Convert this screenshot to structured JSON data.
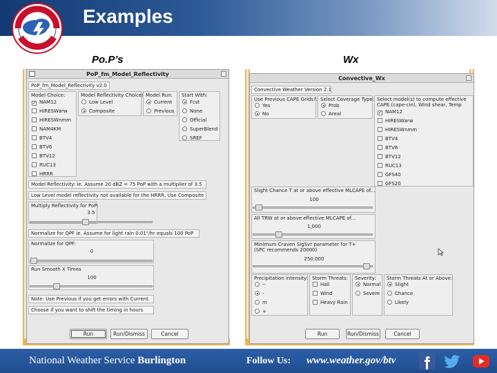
{
  "slide": {
    "title": "Examples",
    "left_label": "Po.P’s",
    "right_label": "Wx"
  },
  "colors": {
    "header_dark": "#143a73",
    "footer_blue": "#1e4c8f",
    "window_accent": "#f1b54e"
  },
  "pop_window": {
    "title": "PoP_fm_Model_Reflectivity",
    "version": "PoP_fm_Model_Reflectivity v2.0",
    "model_choice": {
      "title": "Model Choice:",
      "items": [
        {
          "label": "NAM12",
          "checked": true
        },
        {
          "label": "HIRESWarw",
          "checked": false
        },
        {
          "label": "HIRESWnmm",
          "checked": false
        },
        {
          "label": "NAM4KM",
          "checked": false
        },
        {
          "label": "BTV4",
          "checked": false
        },
        {
          "label": "BTV6",
          "checked": false
        },
        {
          "label": "BTV12",
          "checked": false
        },
        {
          "label": "RUC13",
          "checked": false
        },
        {
          "label": "HRRR",
          "checked": false
        }
      ]
    },
    "reflectivity_choice": {
      "title": "Model Reflectivity Choices:",
      "items": [
        {
          "label": "Low Level",
          "checked": false
        },
        {
          "label": "Composite",
          "checked": true
        }
      ]
    },
    "model_run": {
      "title": "Model Run:",
      "items": [
        {
          "label": "Current",
          "checked": true
        },
        {
          "label": "Previous",
          "checked": false
        }
      ]
    },
    "start_with": {
      "title": "Start With:",
      "items": [
        {
          "label": "Fcst",
          "checked": true
        },
        {
          "label": "None",
          "checked": false
        },
        {
          "label": "Official",
          "checked": false
        },
        {
          "label": "SuperBlend",
          "checked": false
        },
        {
          "label": "SREF",
          "checked": false
        }
      ]
    },
    "note_reflectivity": "Model Reflectivity: ie. Assume 20 dBZ = 75 PoP with a multiplier of 3.5",
    "note_lowlevel": "Low Level model reflectivity not available for the HRRR, Use Composite",
    "multiply": {
      "label": "Multiply Reflectivity for PoP:",
      "value": "3.5",
      "fraction": 0.45
    },
    "normalize_note": "Normalize for QPF ie. Assume for light rain 0.01\"/hr equals 100 PoP",
    "normalize": {
      "label": "Normalize for QPF:",
      "value": "0",
      "fraction": 0.0
    },
    "smooth": {
      "label": "Run Smooth X Times",
      "value": "100",
      "fraction": 0.2
    },
    "note_previous": "Note: Use Previous if you get errors with Current.",
    "note_shift": "Choose if you want to shift the timing in hours",
    "buttons": {
      "run": "Run",
      "run_dismiss": "Run/Dismiss",
      "cancel": "Cancel"
    }
  },
  "wx_window": {
    "title": "Convective_Wx",
    "version": "Convective Weather Version 2.1",
    "use_previous": {
      "title": "Use Previous CAPE Grids?:",
      "items": [
        {
          "label": "Yes",
          "checked": false
        },
        {
          "label": "No",
          "checked": true
        }
      ]
    },
    "coverage": {
      "title": "Select Coverage Type:",
      "items": [
        {
          "label": "Prob",
          "checked": true
        },
        {
          "label": "Areal",
          "checked": false
        }
      ]
    },
    "models": {
      "title": "Select model(s) to compute effective CAPE (cape-cin), Wind shear, Temp",
      "items": [
        {
          "label": "NAM12",
          "checked": true
        },
        {
          "label": "HIRESWarw",
          "checked": false
        },
        {
          "label": "HIRESWnmm",
          "checked": false
        },
        {
          "label": "BTV4",
          "checked": false
        },
        {
          "label": "BTV6",
          "checked": false
        },
        {
          "label": "BTV12",
          "checked": false
        },
        {
          "label": "RUC13",
          "checked": false
        },
        {
          "label": "GFS40",
          "checked": false
        },
        {
          "label": "GFS20",
          "checked": false
        }
      ]
    },
    "slight_chance": {
      "label": "Slight Chance T at or above effective MLCAPE of...",
      "value": "100",
      "fraction": 0.02
    },
    "all_trw": {
      "label": "All TRW at or above effective MLCAPE of...",
      "value": "1,000",
      "fraction": 0.2
    },
    "craven": {
      "label": "Minimum Craven SigSvr parameter for T+",
      "sub": "(SPC recommends 20000)",
      "value": "250,000",
      "fraction": 0.98
    },
    "precip": {
      "title": "Precipitation intensity:",
      "items": [
        {
          "label": "--",
          "checked": false
        },
        {
          "label": "-",
          "checked": true
        },
        {
          "label": "m",
          "checked": false
        },
        {
          "label": "+",
          "checked": false
        }
      ]
    },
    "threats": {
      "title": "Storm Threats:",
      "items": [
        {
          "label": "Hail",
          "checked": false
        },
        {
          "label": "Wind",
          "checked": false
        },
        {
          "label": "Heavy Rain",
          "checked": false
        }
      ]
    },
    "severity": {
      "title": "Severity:",
      "items": [
        {
          "label": "Normal",
          "checked": true
        },
        {
          "label": "Severe",
          "checked": false
        }
      ]
    },
    "threats_above": {
      "title": "Storm Threats At or Above:",
      "items": [
        {
          "label": "Slight",
          "checked": true
        },
        {
          "label": "Chance",
          "checked": false
        },
        {
          "label": "Likely",
          "checked": false
        }
      ]
    },
    "buttons": {
      "run": "Run",
      "run_dismiss": "Run/Dismiss",
      "cancel": "Cancel"
    }
  },
  "footer": {
    "org_prefix": "National Weather Service ",
    "org_office": "Burlington",
    "follow": "Follow Us:",
    "url": "www.weather.gov/btv",
    "icons": [
      "facebook-icon",
      "twitter-icon",
      "youtube-icon"
    ]
  }
}
